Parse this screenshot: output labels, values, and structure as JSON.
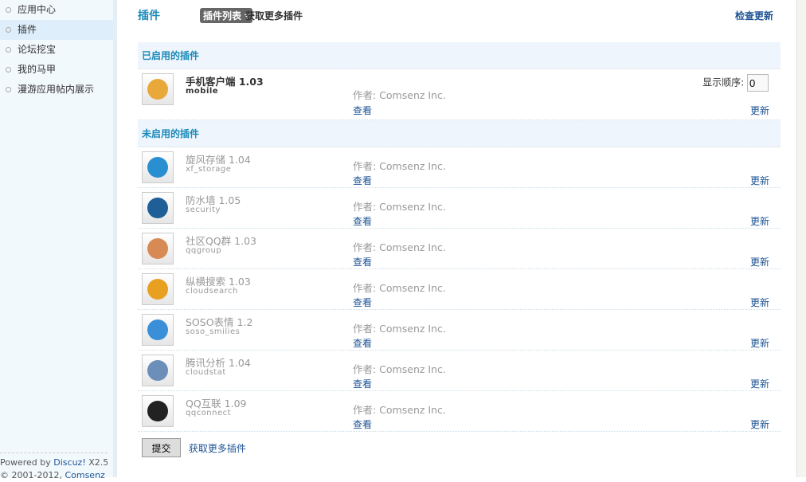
{
  "sidebar": {
    "items": [
      {
        "label": "应用中心"
      },
      {
        "label": "插件",
        "active": true
      },
      {
        "label": "论坛挖宝"
      },
      {
        "label": "我的马甲"
      },
      {
        "label": "漫游应用帖内展示"
      }
    ],
    "footer": {
      "powered": "Powered by ",
      "brand": "Discuz!",
      "version": " X2.5",
      "copy": "© 2001-2012, ",
      "company": "Comsenz Inc."
    }
  },
  "header": {
    "title": "插件",
    "dropdown": "插件列表 ▾",
    "more": "获取更多插件",
    "check": "检查更新"
  },
  "enabled": {
    "heading": "已启用的插件",
    "order_label": "显示顺序:",
    "order_value": "0",
    "plugins": [
      {
        "name": "手机客户端  1.03",
        "id": "mobile",
        "author": "作者: Comsenz Inc.",
        "view": "查看",
        "update": "更新",
        "color": "#e9a93a"
      }
    ]
  },
  "disabled": {
    "heading": "未启用的插件",
    "plugins": [
      {
        "name": "旋风存储  1.04",
        "id": "xf_storage",
        "author": "作者: Comsenz Inc.",
        "view": "查看",
        "update": "更新",
        "color": "#2a8fd0"
      },
      {
        "name": "防水墙  1.05",
        "id": "security",
        "author": "作者: Comsenz Inc.",
        "view": "查看",
        "update": "更新",
        "color": "#1d5f96"
      },
      {
        "name": "社区QQ群  1.03",
        "id": "qqgroup",
        "author": "作者: Comsenz Inc.",
        "view": "查看",
        "update": "更新",
        "color": "#d88a55"
      },
      {
        "name": "纵横搜索  1.03",
        "id": "cloudsearch",
        "author": "作者: Comsenz Inc.",
        "view": "查看",
        "update": "更新",
        "color": "#e8a020"
      },
      {
        "name": "SOSO表情  1.2",
        "id": "soso_smilies",
        "author": "作者: Comsenz Inc.",
        "view": "查看",
        "update": "更新",
        "color": "#3a8fd8"
      },
      {
        "name": "腾讯分析  1.04",
        "id": "cloudstat",
        "author": "作者: Comsenz Inc.",
        "view": "查看",
        "update": "更新",
        "color": "#6b8fb8"
      },
      {
        "name": "QQ互联  1.09",
        "id": "qqconnect",
        "author": "作者: Comsenz Inc.",
        "view": "查看",
        "update": "更新",
        "color": "#222222"
      }
    ]
  },
  "footer": {
    "submit": "提交",
    "more": "获取更多插件"
  }
}
